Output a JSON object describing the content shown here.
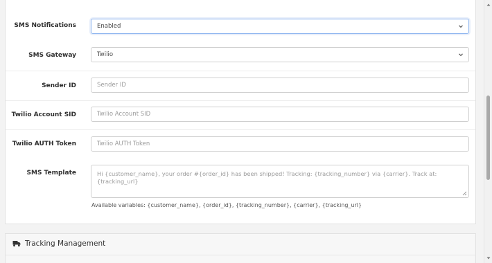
{
  "form": {
    "sms_notifications": {
      "label": "SMS Notifications",
      "value": "Enabled"
    },
    "sms_gateway": {
      "label": "SMS Gateway",
      "value": "Twilio"
    },
    "sender_id": {
      "label": "Sender ID",
      "placeholder": "Sender ID"
    },
    "twilio_account_sid": {
      "label": "Twilio Account SID",
      "placeholder": "Twilio Account SID"
    },
    "twilio_auth_token": {
      "label": "Twilio AUTH Token",
      "placeholder": "Twilio AUTH Token"
    },
    "sms_template": {
      "label": "SMS Template",
      "value": "Hi {customer_name}, your order #{order_id} has been shipped! Tracking: {tracking_number} via {carrier}. Track at: {tracking_url}",
      "help": "Available variables: {customer_name}, {order_id}, {tracking_number}, {carrier}, {tracking_url}"
    }
  },
  "next_panel": {
    "title": "Tracking Management",
    "icon": "truck-icon"
  },
  "scroll_position": 0.38,
  "colors": {
    "focus_border": "#8fb6ef",
    "panel_bg": "#ffffff",
    "page_bg": "#f3f3f3"
  }
}
